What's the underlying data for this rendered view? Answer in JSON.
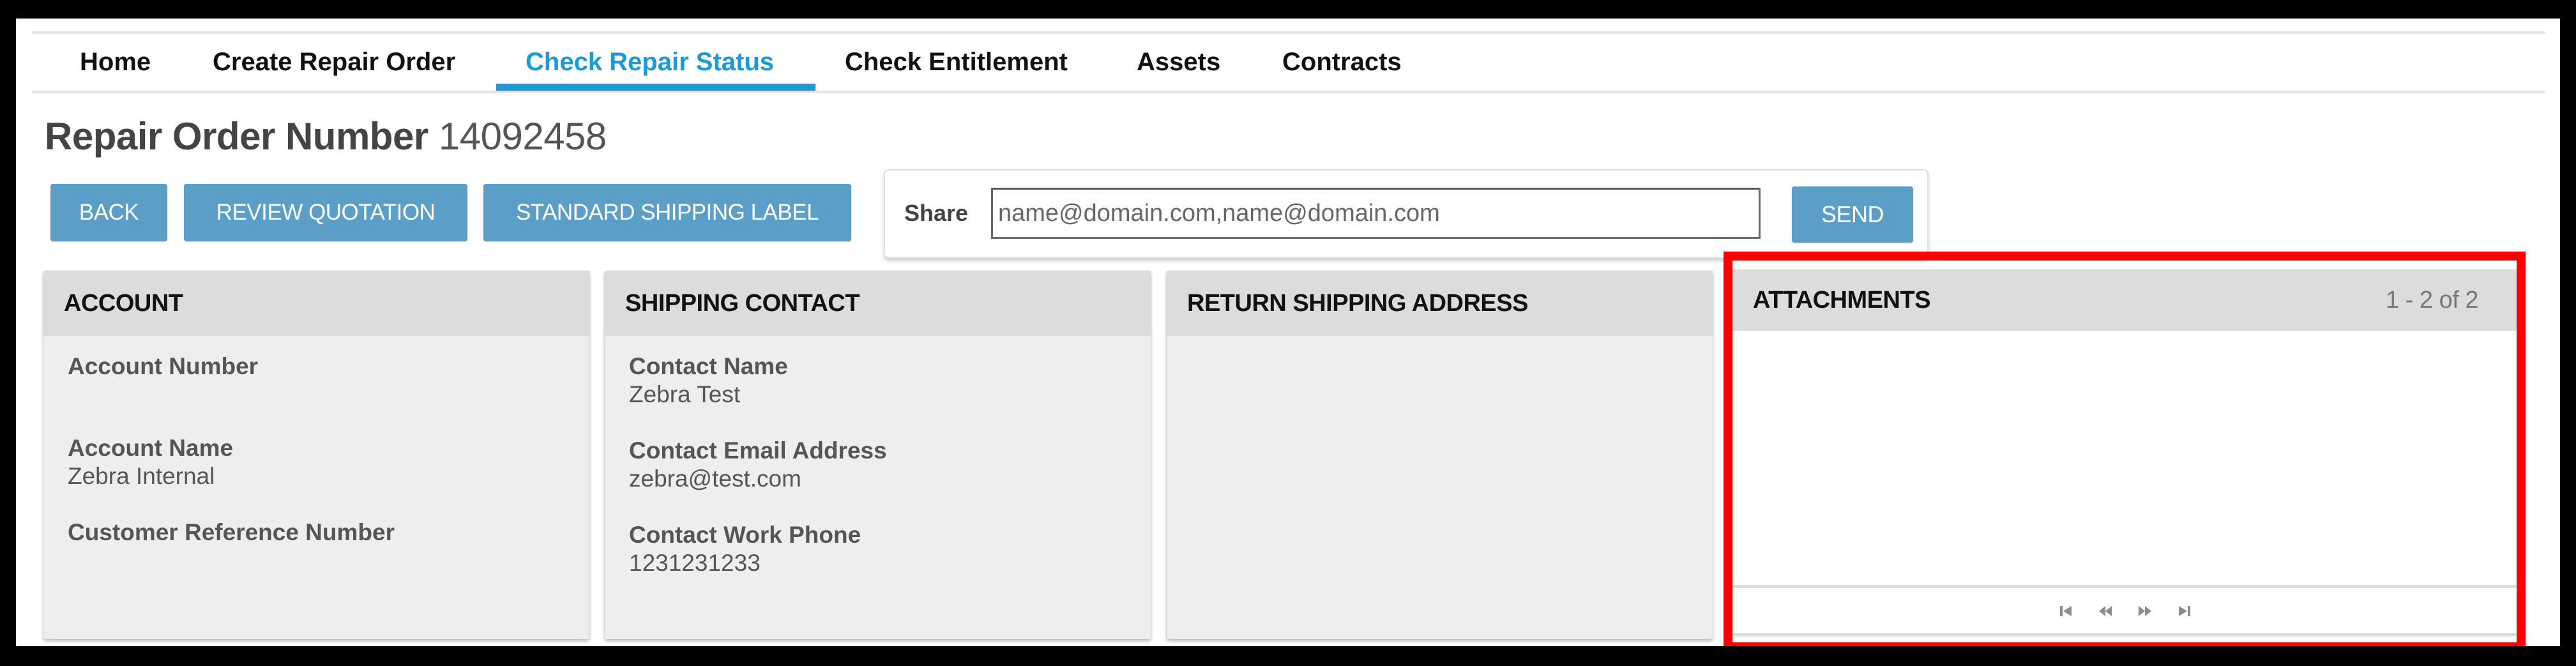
{
  "nav": {
    "tabs": [
      {
        "label": "Home",
        "active": false
      },
      {
        "label": "Create Repair Order",
        "active": false
      },
      {
        "label": "Check Repair Status",
        "active": true
      },
      {
        "label": "Check Entitlement",
        "active": false
      },
      {
        "label": "Assets",
        "active": false
      },
      {
        "label": "Contracts",
        "active": false
      }
    ]
  },
  "header": {
    "title_label": "Repair Order Number",
    "order_number": "14092458"
  },
  "actions": {
    "back": "BACK",
    "review_quotation": "REVIEW QUOTATION",
    "standard_shipping_label": "STANDARD SHIPPING LABEL"
  },
  "share": {
    "label": "Share",
    "placeholder": "name@domain.com,name@domain.com",
    "value": "",
    "send": "SEND"
  },
  "cards": {
    "account": {
      "title": "ACCOUNT",
      "fields": [
        {
          "label": "Account Number",
          "value": ""
        },
        {
          "label": "Account Name",
          "value": "Zebra Internal"
        },
        {
          "label": "Customer Reference Number",
          "value": ""
        }
      ]
    },
    "shipping_contact": {
      "title": "SHIPPING CONTACT",
      "fields": [
        {
          "label": "Contact Name",
          "value": "Zebra Test"
        },
        {
          "label": "Contact Email Address",
          "value": "zebra@test.com"
        },
        {
          "label": "Contact Work Phone",
          "value": "1231231233"
        }
      ]
    },
    "return_shipping_address": {
      "title": "RETURN SHIPPING ADDRESS"
    },
    "attachments": {
      "title": "ATTACHMENTS",
      "count": "1 - 2 of 2",
      "pager_icons": [
        "first-page-icon",
        "previous-page-icon",
        "next-page-icon",
        "last-page-icon"
      ]
    }
  },
  "colors": {
    "accent": "#1a9ad6",
    "button": "#5b9fc8",
    "highlight": "#ff0000"
  }
}
